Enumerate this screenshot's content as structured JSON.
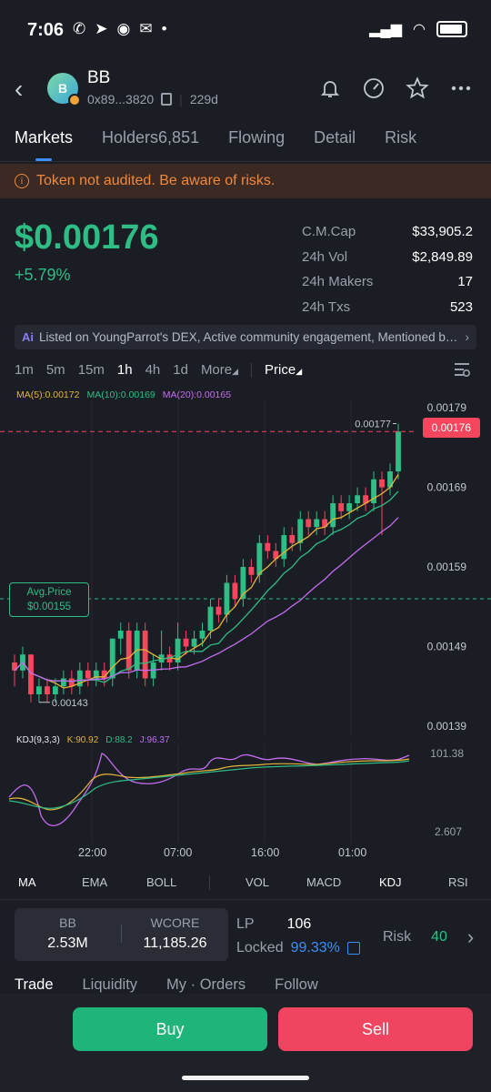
{
  "status": {
    "time": "7:06",
    "dot": "•"
  },
  "token": {
    "avatar_letter": "B",
    "name": "BB",
    "address": "0x89...3820",
    "age": "229d"
  },
  "tabs": [
    "Markets",
    "Holders6,851",
    "Flowing",
    "Detail",
    "Risk"
  ],
  "warning": "Token not audited. Be aware of risks.",
  "price": "$0.00176",
  "change": "+5.79%",
  "stats": [
    {
      "k": "C.M.Cap",
      "v": "$33,905.2"
    },
    {
      "k": "24h Vol",
      "v": "$2,849.89"
    },
    {
      "k": "24h Makers",
      "v": "17"
    },
    {
      "k": "24h Txs",
      "v": "523"
    }
  ],
  "ai_bar": {
    "badge": "Ai",
    "text": "Listed on YoungParrot's DEX, Active community engagement, Mentioned by ..."
  },
  "intervals": [
    "1m",
    "5m",
    "15m",
    "1h",
    "4h",
    "1d",
    "More",
    "Price"
  ],
  "ma_legend": {
    "ma5": "MA(5):0.00172",
    "ma10": "MA(10):0.00169",
    "ma20": "MA(20):0.00165"
  },
  "chart_data": {
    "type": "candlestick",
    "y_ticks": [
      "0.00179",
      "0.00169",
      "0.00159",
      "0.00149",
      "0.00139"
    ],
    "ylim": [
      0.00139,
      0.00179
    ],
    "high_label": "0.00177",
    "low_label": "0.00143",
    "current_price": "0.00176",
    "avg_label": "Avg.Price",
    "avg_price": "$0.00155",
    "avg_value": 0.00155,
    "candles": [
      [
        0.00147,
        0.00146,
        0.00148,
        0.00144
      ],
      [
        0.00146,
        0.00148,
        0.00149,
        0.00145
      ],
      [
        0.00148,
        0.00143,
        0.00148,
        0.00142
      ],
      [
        0.00143,
        0.00144,
        0.00145,
        0.00142
      ],
      [
        0.00144,
        0.00143,
        0.00145,
        0.00142
      ],
      [
        0.00143,
        0.00144,
        0.00145,
        0.00142
      ],
      [
        0.00144,
        0.00145,
        0.00146,
        0.00143
      ],
      [
        0.00145,
        0.00144,
        0.00146,
        0.00143
      ],
      [
        0.00144,
        0.00146,
        0.00147,
        0.00143
      ],
      [
        0.00146,
        0.00145,
        0.00147,
        0.00144
      ],
      [
        0.00145,
        0.00146,
        0.00147,
        0.00144
      ],
      [
        0.00146,
        0.00145,
        0.00147,
        0.00144
      ],
      [
        0.00145,
        0.0015,
        0.0015,
        0.00144
      ],
      [
        0.0015,
        0.00151,
        0.00152,
        0.00148
      ],
      [
        0.00151,
        0.00146,
        0.00152,
        0.00145
      ],
      [
        0.00146,
        0.00151,
        0.00152,
        0.00145
      ],
      [
        0.00151,
        0.00145,
        0.00152,
        0.00144
      ],
      [
        0.00145,
        0.00147,
        0.00148,
        0.00144
      ],
      [
        0.00147,
        0.00148,
        0.00151,
        0.00146
      ],
      [
        0.00148,
        0.00147,
        0.00149,
        0.00146
      ],
      [
        0.00147,
        0.0015,
        0.00152,
        0.00146
      ],
      [
        0.0015,
        0.00149,
        0.00151,
        0.00148
      ],
      [
        0.00149,
        0.0015,
        0.00151,
        0.00148
      ],
      [
        0.0015,
        0.00151,
        0.00152,
        0.00149
      ],
      [
        0.00151,
        0.00154,
        0.00155,
        0.0015
      ],
      [
        0.00154,
        0.00153,
        0.00155,
        0.00152
      ],
      [
        0.00153,
        0.00157,
        0.00158,
        0.00152
      ],
      [
        0.00157,
        0.00155,
        0.00158,
        0.00154
      ],
      [
        0.00155,
        0.00159,
        0.0016,
        0.00154
      ],
      [
        0.00159,
        0.00158,
        0.0016,
        0.00157
      ],
      [
        0.00158,
        0.00162,
        0.00163,
        0.00157
      ],
      [
        0.00162,
        0.00161,
        0.00163,
        0.0016
      ],
      [
        0.00161,
        0.0016,
        0.00162,
        0.00159
      ],
      [
        0.0016,
        0.00163,
        0.00164,
        0.00159
      ],
      [
        0.00163,
        0.00162,
        0.00164,
        0.00161
      ],
      [
        0.00162,
        0.00165,
        0.00166,
        0.00161
      ],
      [
        0.00165,
        0.00164,
        0.00166,
        0.00163
      ],
      [
        0.00164,
        0.00165,
        0.00166,
        0.00163
      ],
      [
        0.00165,
        0.00164,
        0.00166,
        0.00163
      ],
      [
        0.00164,
        0.00167,
        0.00168,
        0.00163
      ],
      [
        0.00167,
        0.00166,
        0.00168,
        0.00165
      ],
      [
        0.00166,
        0.00167,
        0.00168,
        0.00165
      ],
      [
        0.00167,
        0.00168,
        0.00169,
        0.00166
      ],
      [
        0.00168,
        0.00167,
        0.00169,
        0.00166
      ],
      [
        0.00167,
        0.0017,
        0.00171,
        0.00166
      ],
      [
        0.0017,
        0.00169,
        0.00171,
        0.00163
      ],
      [
        0.00169,
        0.00171,
        0.00172,
        0.00168
      ],
      [
        0.00171,
        0.00176,
        0.00177,
        0.0017
      ]
    ]
  },
  "kdj_legend": {
    "name": "KDJ(9,3,3)",
    "k": "K:90.92",
    "d": "D:88.2",
    "j": "J:96.37"
  },
  "kdj_ticks": [
    "101.38",
    "2.607"
  ],
  "time_axis": [
    "22:00",
    "07:00",
    "16:00",
    "01:00"
  ],
  "indicator_tabs": [
    "MA",
    "EMA",
    "BOLL",
    "VOL",
    "MACD",
    "KDJ",
    "RSI"
  ],
  "pair": {
    "base": "BB",
    "base_amt": "2.53M",
    "quote": "WCORE",
    "quote_amt": "11,185.26"
  },
  "lp": {
    "label": "LP",
    "value": "106",
    "locked_label": "Locked",
    "locked_value": "99.33%"
  },
  "risk": {
    "label": "Risk",
    "value": "40"
  },
  "bottom_tabs": [
    "Trade",
    "Liquidity",
    "My · Orders",
    "Follow"
  ],
  "buy_label": "Buy",
  "sell_label": "Sell",
  "colors": {
    "up": "#2ebd85",
    "down": "#f6465d",
    "accent": "#3d8ef7",
    "warning": "#f0883e"
  }
}
